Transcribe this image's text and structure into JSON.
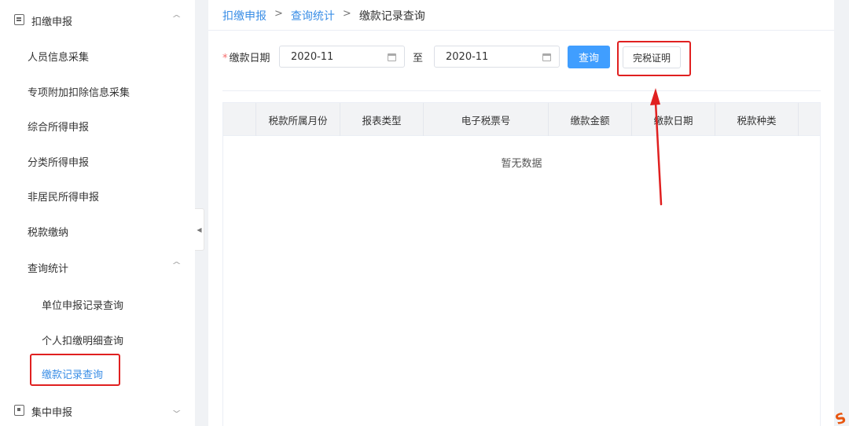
{
  "sidebar": {
    "groups": [
      {
        "label": "扣缴申报",
        "icon": "document-icon",
        "expanded": true
      },
      {
        "label": "集中申报",
        "icon": "box-icon",
        "expanded": false
      }
    ],
    "items": [
      {
        "label": "人员信息采集"
      },
      {
        "label": "专项附加扣除信息采集"
      },
      {
        "label": "综合所得申报"
      },
      {
        "label": "分类所得申报"
      },
      {
        "label": "非居民所得申报"
      },
      {
        "label": "税款缴纳"
      },
      {
        "label": "查询统计"
      }
    ],
    "subitems": [
      {
        "label": "单位申报记录查询"
      },
      {
        "label": "个人扣缴明细查询"
      },
      {
        "label": "缴款记录查询",
        "active": true
      }
    ]
  },
  "breadcrumb": {
    "items": [
      "扣缴申报",
      "查询统计",
      "缴款记录查询"
    ],
    "separator": ">"
  },
  "filter": {
    "label": "缴款日期",
    "required_mark": "*",
    "start_date": "2020-11",
    "to_label": "至",
    "end_date": "2020-11",
    "query_button": "查询",
    "cert_button": "完税证明"
  },
  "table": {
    "columns": [
      "",
      "税款所属月份",
      "报表类型",
      "电子税票号",
      "缴款金额",
      "缴款日期",
      "税款种类",
      ""
    ],
    "rows": [],
    "empty_text": "暂无数据"
  },
  "colors": {
    "accent": "#409eff",
    "link": "#3a8ee6",
    "annotation": "#e02020"
  }
}
